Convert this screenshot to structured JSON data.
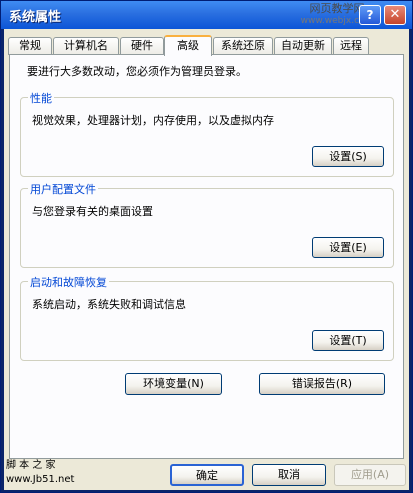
{
  "window": {
    "title": "系统属性",
    "watermark": {
      "main": "网页教学网",
      "sub": "www.webjx.com"
    }
  },
  "tabs": [
    {
      "label": "常规"
    },
    {
      "label": "计算机名"
    },
    {
      "label": "硬件"
    },
    {
      "label": "高级"
    },
    {
      "label": "系统还原"
    },
    {
      "label": "自动更新"
    },
    {
      "label": "远程"
    }
  ],
  "advanced": {
    "intro": "要进行大多数改动，您必须作为管理员登录。",
    "performance": {
      "title": "性能",
      "description": "视觉效果，处理器计划，内存使用，以及虚拟内存",
      "settings_label": "设置(S)"
    },
    "user_profiles": {
      "title": "用户配置文件",
      "description": "与您登录有关的桌面设置",
      "settings_label": "设置(E)"
    },
    "startup_recovery": {
      "title": "启动和故障恢复",
      "description": "系统启动，系统失败和调试信息",
      "settings_label": "设置(T)"
    },
    "env_vars_label": "环境变量(N)",
    "error_report_label": "错误报告(R)"
  },
  "footer": {
    "site_name": "脚 本 之 家",
    "site_url": "www.Jb51.net",
    "ok_label": "确定",
    "cancel_label": "取消",
    "apply_label": "应用(A)"
  },
  "colors": {
    "title_bar": "#0c55d7",
    "group_title": "#0046d5",
    "active_tab_highlight": "#f9b03f"
  }
}
